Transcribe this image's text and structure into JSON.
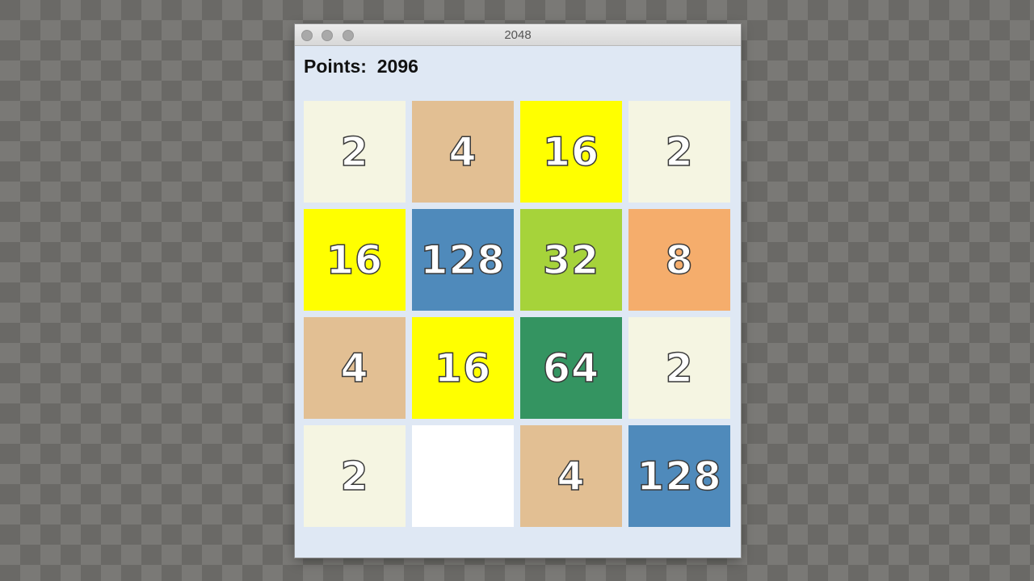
{
  "window": {
    "title": "2048"
  },
  "score": {
    "label": "Points:",
    "value": "2096"
  },
  "board": {
    "tiles": [
      {
        "value": "2",
        "color": "#f5f5e2"
      },
      {
        "value": "4",
        "color": "#e2bf93"
      },
      {
        "value": "16",
        "color": "#ffff00"
      },
      {
        "value": "2",
        "color": "#f5f5e2"
      },
      {
        "value": "16",
        "color": "#ffff00"
      },
      {
        "value": "128",
        "color": "#4f8abb"
      },
      {
        "value": "32",
        "color": "#a6d33a"
      },
      {
        "value": "8",
        "color": "#f5ad6c"
      },
      {
        "value": "4",
        "color": "#e2bf93"
      },
      {
        "value": "16",
        "color": "#ffff00"
      },
      {
        "value": "64",
        "color": "#349461"
      },
      {
        "value": "2",
        "color": "#f5f5e2"
      },
      {
        "value": "2",
        "color": "#f5f5e2"
      },
      {
        "value": "",
        "color": "#ffffff"
      },
      {
        "value": "4",
        "color": "#e2bf93"
      },
      {
        "value": "128",
        "color": "#4f8abb"
      }
    ]
  }
}
